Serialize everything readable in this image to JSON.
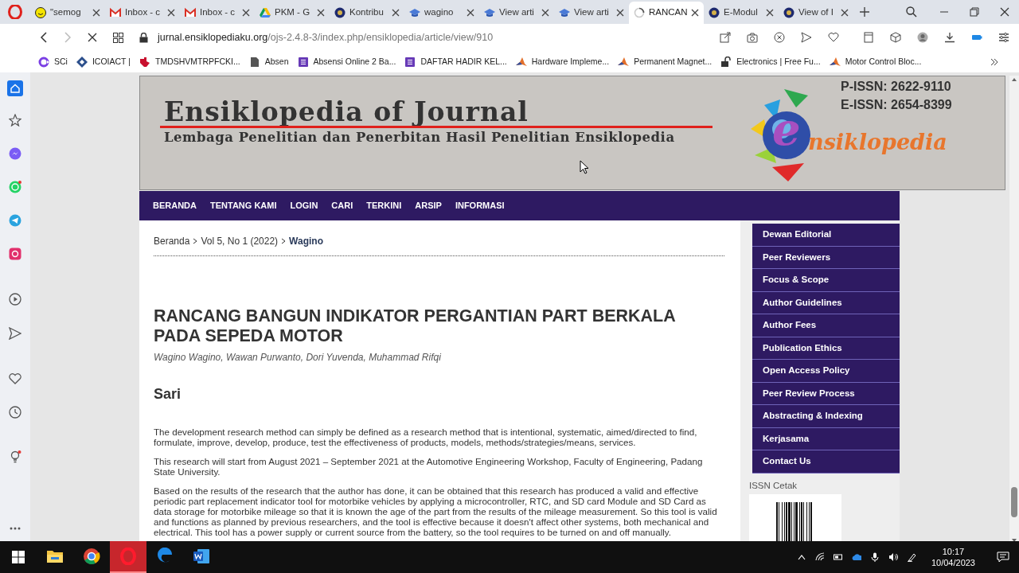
{
  "browser": {
    "tabs": [
      {
        "title": "\"semog",
        "kind": "smiley",
        "selected": false
      },
      {
        "title": "Inbox - c",
        "kind": "mail",
        "selected": false
      },
      {
        "title": "Inbox - c",
        "kind": "mail",
        "selected": false
      },
      {
        "title": "PKM - G",
        "kind": "drive",
        "selected": false
      },
      {
        "title": "Kontribu",
        "kind": "crest",
        "selected": false
      },
      {
        "title": "wagino",
        "kind": "cap",
        "selected": false
      },
      {
        "title": "View arti",
        "kind": "cap",
        "selected": false
      },
      {
        "title": "View arti",
        "kind": "cap",
        "selected": false
      },
      {
        "title": "RANCAN",
        "kind": "spinner",
        "selected": true
      },
      {
        "title": "E-Modul",
        "kind": "crest",
        "selected": false
      },
      {
        "title": "View of I",
        "kind": "crest",
        "selected": false
      }
    ],
    "address": {
      "domain": "jurnal.ensiklopediaku.org",
      "path": "/ojs-2.4.8-3/index.php/ensiklopedia/article/view/910"
    },
    "bookmarks": [
      {
        "label": "SCi",
        "kind": "ring"
      },
      {
        "label": "ICOIACT |",
        "kind": "diamond"
      },
      {
        "label": "TMDSHVMTRPFCKI...",
        "kind": "chip"
      },
      {
        "label": "Absen",
        "kind": "doc"
      },
      {
        "label": "Absensi Online 2 Ba...",
        "kind": "form"
      },
      {
        "label": "DAFTAR HADIR KEL...",
        "kind": "form"
      },
      {
        "label": "Hardware Impleme...",
        "kind": "peak"
      },
      {
        "label": "Permanent Magnet...",
        "kind": "peak"
      },
      {
        "label": "Electronics | Free Fu...",
        "kind": "lock"
      },
      {
        "label": "Motor Control Bloc...",
        "kind": "peak"
      }
    ]
  },
  "header": {
    "title": "Ensiklopedia of Journal",
    "subtitle": "Lembaga Penelitian dan Penerbitan Hasil Penelitian Ensiklopedia",
    "p_issn": "P-ISSN: 2622-9110",
    "e_issn": "E-ISSN: 2654-8399",
    "logo_initial": "e",
    "logo_rest": "nsiklopedia"
  },
  "nav": [
    "BERANDA",
    "TENTANG KAMI",
    "LOGIN",
    "CARI",
    "TERKINI",
    "ARSIP",
    "INFORMASI"
  ],
  "breadcrumb": [
    {
      "label": "Beranda",
      "current": false
    },
    {
      "label": "Vol 5, No 1 (2022)",
      "current": false
    },
    {
      "label": "Wagino",
      "current": true
    }
  ],
  "article": {
    "title": "RANCANG BANGUN INDIKATOR PERGANTIAN PART BERKALA PADA SEPEDA MOTOR",
    "authors": "Wagino Wagino, Wawan Purwanto, Dori Yuvenda, Muhammad Rifqi",
    "section": "Sari",
    "paragraphs": [
      "The development research method can simply be defined as a research method that is intentional, systematic, aimed/directed to find, formulate, improve, develop, produce, test the effectiveness of products, models, methods/strategies/means, services.",
      "This research will start from August 2021 – September 2021 at the Automotive Engineering Workshop, Faculty of Engineering, Padang State University.",
      "Based on the results of the research that the author has done, it can be obtained that this research has produced a valid and effective periodic part replacement indicator tool for motorbike vehicles by applying a microcontroller, RTC, and SD card Module and SD Card as data storage for motorbike mileage so that it is known the age of the part from the results of the mileage measurement. So this tool is valid and functions as planned by previous researchers, and the tool is effective because it doesn't affect other systems, both mechanical and electrical. This tool has a power supply or current source from the battery, so the tool requires to be turned on and off manually."
    ]
  },
  "sidebar": {
    "menu": [
      "Dewan Editorial",
      "Peer Reviewers",
      "Focus & Scope",
      "Author Guidelines",
      "Author Fees",
      "Publication Ethics",
      "Open Access Policy",
      "Peer Review Process",
      "Abstracting & Indexing",
      "Kerjasama",
      "Contact Us"
    ],
    "issn_label": "ISSN Cetak"
  },
  "taskbar": {
    "apps": [
      {
        "kind": "folder",
        "active": false
      },
      {
        "kind": "chrome",
        "active": false
      },
      {
        "kind": "opera",
        "active": true
      },
      {
        "kind": "edge",
        "active": false
      },
      {
        "kind": "word",
        "active": false
      }
    ],
    "time": "10:17",
    "date": "10/04/2023"
  }
}
